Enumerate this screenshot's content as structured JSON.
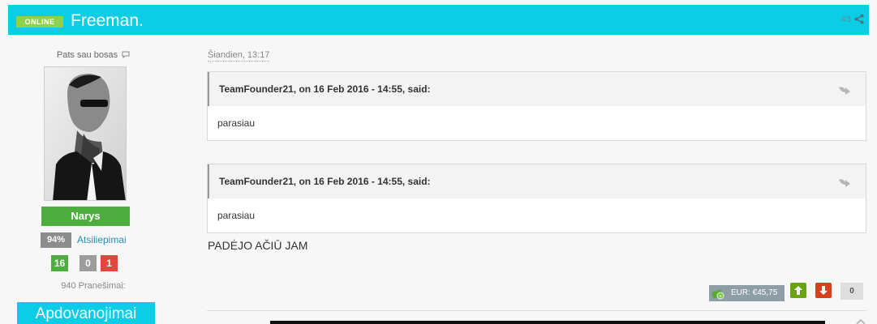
{
  "post": {
    "status_badge": "ONLINE",
    "username": "Freeman.",
    "post_number": "#3",
    "date": "Šiandien, 13:17",
    "text": "PADĖJO AČIŪ JAM"
  },
  "user": {
    "title": "Pats sau bosas",
    "group": "Narys",
    "rating_pct": "94%",
    "feedback_label": "Atsiliepimai",
    "rep_positive": "16",
    "rep_neutral": "0",
    "rep_negative": "1",
    "post_count": "940 Pranešimai:",
    "awards_label": "Apdovanojimai"
  },
  "quotes": [
    {
      "cite": "TeamFounder21, on 16 Feb 2016 - 14:55, said:",
      "body": "parasiau"
    },
    {
      "cite": "TeamFounder21, on 16 Feb 2016 - 14:55, said:",
      "body": "parasiau"
    }
  ],
  "footer": {
    "money": "EUR: €45,75",
    "score": "0"
  },
  "colors": {
    "header": "#0ccde6",
    "online": "#8cd34a",
    "group": "#4caf3d",
    "vote_up": "#6aa414",
    "vote_down": "#d2421f"
  },
  "icons": [
    "share-icon",
    "speech-bubble-icon",
    "quote-arrow-icon",
    "money-icon",
    "arrow-up-icon",
    "arrow-down-icon"
  ]
}
